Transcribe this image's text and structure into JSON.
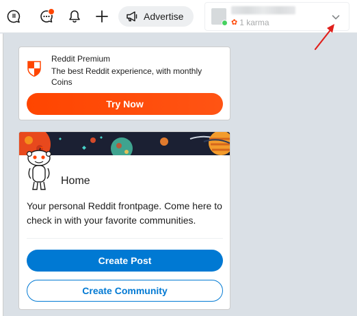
{
  "header": {
    "advertise_label": "Advertise",
    "user": {
      "karma": "1 karma"
    }
  },
  "premium": {
    "title": "Reddit Premium",
    "description": "The best Reddit experience, with monthly Coins",
    "button_label": "Try Now"
  },
  "home": {
    "title": "Home",
    "description": "Your personal Reddit frontpage. Come here to check in with your favorite communities.",
    "create_post_label": "Create Post",
    "create_community_label": "Create Community"
  },
  "colors": {
    "brand_orange": "#ff4500",
    "primary_blue": "#0079d3",
    "online_green": "#46d160",
    "background": "#dae0e6"
  },
  "icons": [
    "popular-icon",
    "chat-icon",
    "bell-icon",
    "plus-icon",
    "megaphone-icon",
    "chevron-down-icon",
    "premium-shield-icon"
  ]
}
